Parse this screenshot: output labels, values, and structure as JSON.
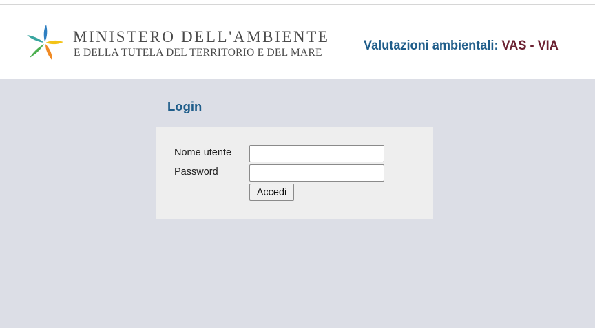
{
  "header": {
    "logo_icon": "ministry-star-logo",
    "ministry_name_line1": "MINISTERO DELL'AMBIENTE",
    "ministry_name_line2": "E DELLA TUTELA DEL TERRITORIO E DEL MARE",
    "site_title_prefix": "Valutazioni ambientali: ",
    "site_title_accent": "VAS - VIA"
  },
  "login": {
    "heading": "Login",
    "username_label": "Nome utente",
    "username_value": "",
    "password_label": "Password",
    "password_value": "",
    "submit_label": "Accedi"
  },
  "colors": {
    "page_background": "#dcdee6",
    "header_background": "#ffffff",
    "panel_background": "#eeeeee",
    "title_blue": "#1f5d8a",
    "title_accent": "#6b2131"
  }
}
